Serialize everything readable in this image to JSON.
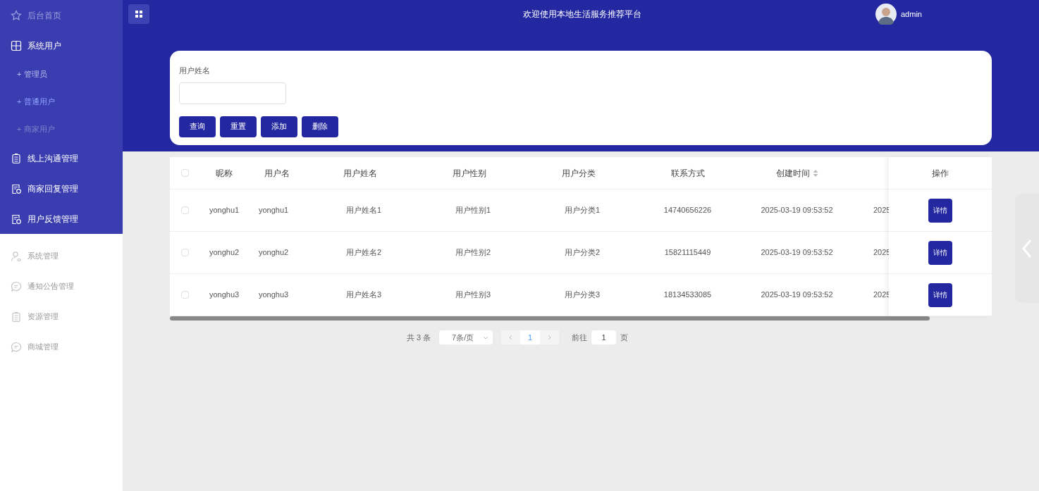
{
  "header": {
    "title": "欢迎使用本地生活服务推荐平台",
    "user": "admin"
  },
  "sidebar": {
    "top_items": [
      {
        "label": "后台首页"
      },
      {
        "label": "系统用户",
        "expanded": true,
        "children": [
          {
            "bullet": "+",
            "label": "管理员",
            "selected": false
          },
          {
            "bullet": "+",
            "label": "普通用户",
            "selected": true
          },
          {
            "bullet": "+",
            "label": "商家用户",
            "selected": false
          }
        ]
      },
      {
        "label": "线上沟通管理"
      },
      {
        "label": "商家回复管理"
      },
      {
        "label": "用户反馈管理"
      }
    ],
    "bottom_items": [
      {
        "label": "系统管理"
      },
      {
        "label": "通知公告管理"
      },
      {
        "label": "资源管理"
      },
      {
        "label": "商城管理"
      }
    ]
  },
  "search": {
    "label": "用户姓名",
    "buttons": [
      "查询",
      "重置",
      "添加",
      "删除"
    ]
  },
  "table": {
    "header_checked": false,
    "columns": [
      {
        "label": "昵称",
        "sortable": false
      },
      {
        "label": "用户名",
        "sortable": false
      },
      {
        "label": "用户姓名",
        "sortable": false
      },
      {
        "label": "用户性别",
        "sortable": false
      },
      {
        "label": "用户分类",
        "sortable": false
      },
      {
        "label": "联系方式",
        "sortable": false
      },
      {
        "label": "创建时间",
        "sortable": true
      }
    ],
    "action_column": "操作",
    "rows": [
      {
        "checked": false,
        "cells": [
          "yonghu1",
          "yonghu1",
          "用户姓名1",
          "用户性别1",
          "用户分类1",
          "14740656226",
          "2025-03-19 09:53:52"
        ],
        "column_9": "2025",
        "action": "详情"
      },
      {
        "checked": false,
        "cells": [
          "yonghu2",
          "yonghu2",
          "用户姓名2",
          "用户性别2",
          "用户分类2",
          "15821115449",
          "2025-03-19 09:53:52"
        ],
        "column_9": "2025",
        "action": "详情"
      },
      {
        "checked": false,
        "cells": [
          "yonghu3",
          "yonghu3",
          "用户姓名3",
          "用户性别3",
          "用户分类3",
          "18134533085",
          "2025-03-19 09:53:52"
        ],
        "column_9": "2025",
        "action": "详情"
      }
    ]
  },
  "pagination": {
    "total": "共 3 条",
    "page_size": "7条/页",
    "pages": [
      {
        "label": "1",
        "selected": true
      }
    ],
    "goto_label": "前往",
    "goto_value": "1",
    "goto_suffix": "页"
  }
}
